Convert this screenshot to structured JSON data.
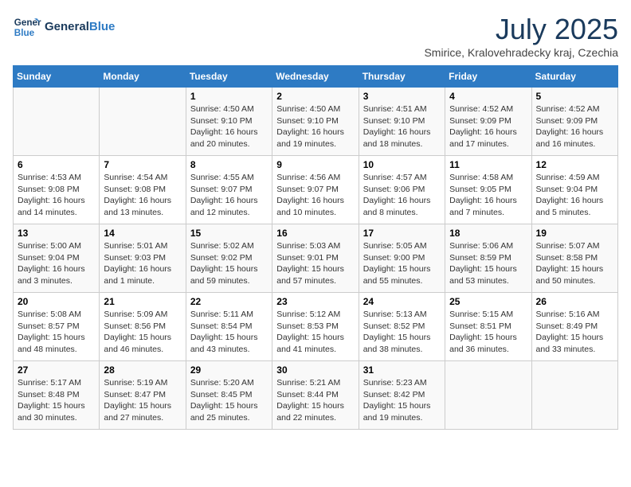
{
  "logo": {
    "line1": "General",
    "line2": "Blue"
  },
  "title": "July 2025",
  "subtitle": "Smirice, Kralovehradecky kraj, Czechia",
  "headers": [
    "Sunday",
    "Monday",
    "Tuesday",
    "Wednesday",
    "Thursday",
    "Friday",
    "Saturday"
  ],
  "weeks": [
    [
      {
        "day": "",
        "info": ""
      },
      {
        "day": "",
        "info": ""
      },
      {
        "day": "1",
        "info": "Sunrise: 4:50 AM\nSunset: 9:10 PM\nDaylight: 16 hours\nand 20 minutes."
      },
      {
        "day": "2",
        "info": "Sunrise: 4:50 AM\nSunset: 9:10 PM\nDaylight: 16 hours\nand 19 minutes."
      },
      {
        "day": "3",
        "info": "Sunrise: 4:51 AM\nSunset: 9:10 PM\nDaylight: 16 hours\nand 18 minutes."
      },
      {
        "day": "4",
        "info": "Sunrise: 4:52 AM\nSunset: 9:09 PM\nDaylight: 16 hours\nand 17 minutes."
      },
      {
        "day": "5",
        "info": "Sunrise: 4:52 AM\nSunset: 9:09 PM\nDaylight: 16 hours\nand 16 minutes."
      }
    ],
    [
      {
        "day": "6",
        "info": "Sunrise: 4:53 AM\nSunset: 9:08 PM\nDaylight: 16 hours\nand 14 minutes."
      },
      {
        "day": "7",
        "info": "Sunrise: 4:54 AM\nSunset: 9:08 PM\nDaylight: 16 hours\nand 13 minutes."
      },
      {
        "day": "8",
        "info": "Sunrise: 4:55 AM\nSunset: 9:07 PM\nDaylight: 16 hours\nand 12 minutes."
      },
      {
        "day": "9",
        "info": "Sunrise: 4:56 AM\nSunset: 9:07 PM\nDaylight: 16 hours\nand 10 minutes."
      },
      {
        "day": "10",
        "info": "Sunrise: 4:57 AM\nSunset: 9:06 PM\nDaylight: 16 hours\nand 8 minutes."
      },
      {
        "day": "11",
        "info": "Sunrise: 4:58 AM\nSunset: 9:05 PM\nDaylight: 16 hours\nand 7 minutes."
      },
      {
        "day": "12",
        "info": "Sunrise: 4:59 AM\nSunset: 9:04 PM\nDaylight: 16 hours\nand 5 minutes."
      }
    ],
    [
      {
        "day": "13",
        "info": "Sunrise: 5:00 AM\nSunset: 9:04 PM\nDaylight: 16 hours\nand 3 minutes."
      },
      {
        "day": "14",
        "info": "Sunrise: 5:01 AM\nSunset: 9:03 PM\nDaylight: 16 hours\nand 1 minute."
      },
      {
        "day": "15",
        "info": "Sunrise: 5:02 AM\nSunset: 9:02 PM\nDaylight: 15 hours\nand 59 minutes."
      },
      {
        "day": "16",
        "info": "Sunrise: 5:03 AM\nSunset: 9:01 PM\nDaylight: 15 hours\nand 57 minutes."
      },
      {
        "day": "17",
        "info": "Sunrise: 5:05 AM\nSunset: 9:00 PM\nDaylight: 15 hours\nand 55 minutes."
      },
      {
        "day": "18",
        "info": "Sunrise: 5:06 AM\nSunset: 8:59 PM\nDaylight: 15 hours\nand 53 minutes."
      },
      {
        "day": "19",
        "info": "Sunrise: 5:07 AM\nSunset: 8:58 PM\nDaylight: 15 hours\nand 50 minutes."
      }
    ],
    [
      {
        "day": "20",
        "info": "Sunrise: 5:08 AM\nSunset: 8:57 PM\nDaylight: 15 hours\nand 48 minutes."
      },
      {
        "day": "21",
        "info": "Sunrise: 5:09 AM\nSunset: 8:56 PM\nDaylight: 15 hours\nand 46 minutes."
      },
      {
        "day": "22",
        "info": "Sunrise: 5:11 AM\nSunset: 8:54 PM\nDaylight: 15 hours\nand 43 minutes."
      },
      {
        "day": "23",
        "info": "Sunrise: 5:12 AM\nSunset: 8:53 PM\nDaylight: 15 hours\nand 41 minutes."
      },
      {
        "day": "24",
        "info": "Sunrise: 5:13 AM\nSunset: 8:52 PM\nDaylight: 15 hours\nand 38 minutes."
      },
      {
        "day": "25",
        "info": "Sunrise: 5:15 AM\nSunset: 8:51 PM\nDaylight: 15 hours\nand 36 minutes."
      },
      {
        "day": "26",
        "info": "Sunrise: 5:16 AM\nSunset: 8:49 PM\nDaylight: 15 hours\nand 33 minutes."
      }
    ],
    [
      {
        "day": "27",
        "info": "Sunrise: 5:17 AM\nSunset: 8:48 PM\nDaylight: 15 hours\nand 30 minutes."
      },
      {
        "day": "28",
        "info": "Sunrise: 5:19 AM\nSunset: 8:47 PM\nDaylight: 15 hours\nand 27 minutes."
      },
      {
        "day": "29",
        "info": "Sunrise: 5:20 AM\nSunset: 8:45 PM\nDaylight: 15 hours\nand 25 minutes."
      },
      {
        "day": "30",
        "info": "Sunrise: 5:21 AM\nSunset: 8:44 PM\nDaylight: 15 hours\nand 22 minutes."
      },
      {
        "day": "31",
        "info": "Sunrise: 5:23 AM\nSunset: 8:42 PM\nDaylight: 15 hours\nand 19 minutes."
      },
      {
        "day": "",
        "info": ""
      },
      {
        "day": "",
        "info": ""
      }
    ]
  ]
}
